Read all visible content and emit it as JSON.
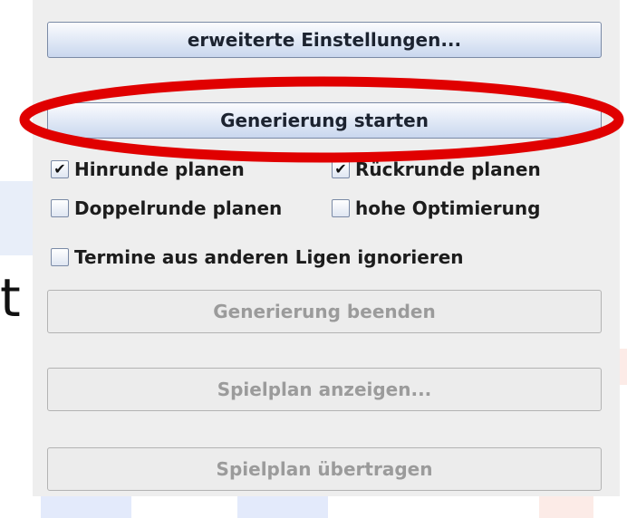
{
  "panel": {
    "advanced_settings_label": "erweiterte Einstellungen...",
    "start_generation_label": "Generierung starten",
    "end_generation_label": "Generierung beenden",
    "show_schedule_label": "Spielplan anzeigen...",
    "transfer_schedule_label": "Spielplan übertragen"
  },
  "checkboxes": {
    "first_half": {
      "label": "Hinrunde planen",
      "checked": true
    },
    "second_half": {
      "label": "Rückrunde planen",
      "checked": true
    },
    "double_round": {
      "label": "Doppelrunde planen",
      "checked": false
    },
    "high_optimization": {
      "label": "hohe Optimierung",
      "checked": false
    },
    "ignore_other_leagues": {
      "label": "Termine aus anderen Ligen ignorieren",
      "checked": false
    }
  },
  "background": {
    "partial_letter": "t"
  },
  "colors": {
    "highlight_ellipse": "#e00000",
    "panel_bg": "#eeeeee"
  }
}
